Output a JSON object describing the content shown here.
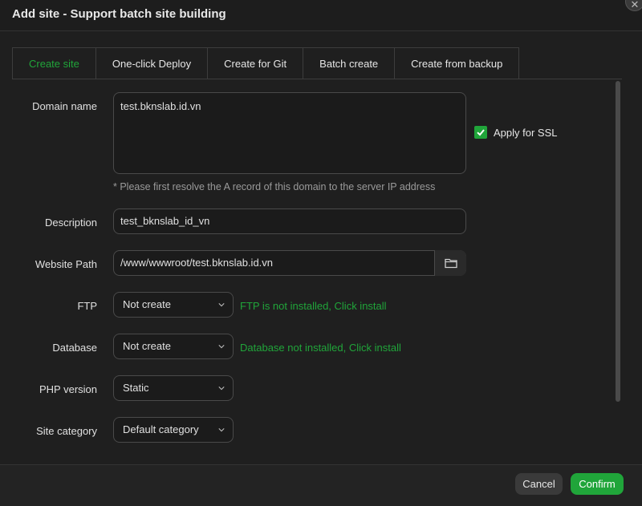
{
  "dialog": {
    "title": "Add site - Support batch site building",
    "close_glyph": "✕"
  },
  "tabs": [
    {
      "label": "Create site",
      "active": true
    },
    {
      "label": "One-click Deploy",
      "active": false
    },
    {
      "label": "Create for Git",
      "active": false
    },
    {
      "label": "Batch create",
      "active": false
    },
    {
      "label": "Create from backup",
      "active": false
    }
  ],
  "form": {
    "domain": {
      "label": "Domain name",
      "value": "test.bknslab.id.vn",
      "hint": "* Please first resolve the A record of this domain to the server IP address"
    },
    "ssl": {
      "label": "Apply for SSL",
      "checked": true
    },
    "description": {
      "label": "Description",
      "value": "test_bknslab_id_vn"
    },
    "website_path": {
      "label": "Website Path",
      "value": "/www/wwwroot/test.bknslab.id.vn",
      "icon": "folder-icon"
    },
    "ftp": {
      "label": "FTP",
      "selected": "Not create",
      "status": "FTP is not installed, Click install"
    },
    "database": {
      "label": "Database",
      "selected": "Not create",
      "status": "Database not installed, Click install"
    },
    "php_version": {
      "label": "PHP version",
      "selected": "Static"
    },
    "site_category": {
      "label": "Site category",
      "selected": "Default category"
    }
  },
  "footer": {
    "cancel_label": "Cancel",
    "confirm_label": "Confirm"
  },
  "colors": {
    "accent": "#20a53a",
    "background": "#1f1f1f"
  }
}
